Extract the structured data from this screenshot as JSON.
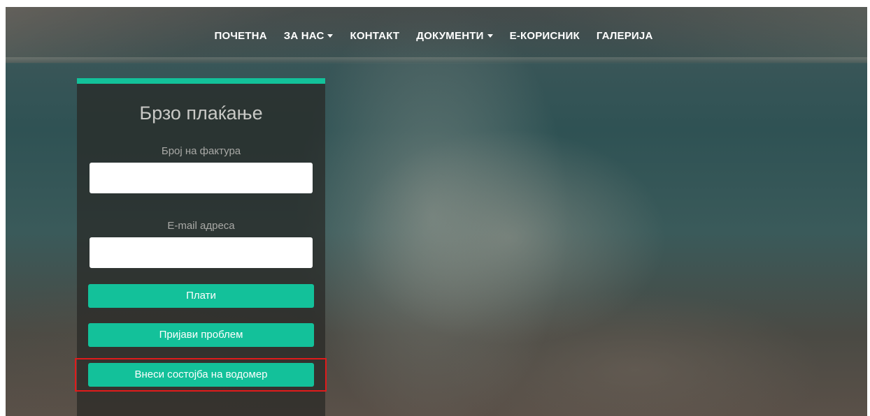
{
  "nav": {
    "items": [
      {
        "label": "ПОЧЕТНА",
        "dropdown": false
      },
      {
        "label": "ЗА НАС",
        "dropdown": true
      },
      {
        "label": "КОНТАКТ",
        "dropdown": false
      },
      {
        "label": "ДОКУМЕНТИ",
        "dropdown": true
      },
      {
        "label": "Е-КОРИСНИК",
        "dropdown": false
      },
      {
        "label": "ГАЛЕРИЈА",
        "dropdown": false
      }
    ]
  },
  "payment_form": {
    "title": "Брзо плаќање",
    "invoice_label": "Број на фактура",
    "invoice_value": "",
    "email_label": "E-mail адреса",
    "email_value": "",
    "pay_button": "Плати",
    "report_button": "Пријави проблем",
    "meter_button": "Внеси состојба на водомер"
  },
  "colors": {
    "accent": "#13c19a",
    "highlight": "#e01b1b"
  }
}
